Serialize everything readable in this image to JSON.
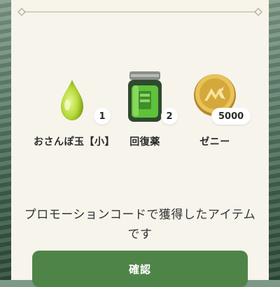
{
  "items": [
    {
      "name": "おさんぽ玉【小】",
      "count": "1",
      "icon": "green-drop-icon"
    },
    {
      "name": "回復薬",
      "count": "2",
      "icon": "potion-jar-icon"
    },
    {
      "name": "ゼニー",
      "count": "5000",
      "icon": "zenny-coin-icon"
    }
  ],
  "message": {
    "line1": "プロモーションコードで獲得したアイテム",
    "line2": "です"
  },
  "confirm_label": "確認",
  "colors": {
    "dialog_bg": "#f7f4ec",
    "button": "#4f8448",
    "coin": "#d4a83a",
    "potion": "#5ec23a"
  }
}
